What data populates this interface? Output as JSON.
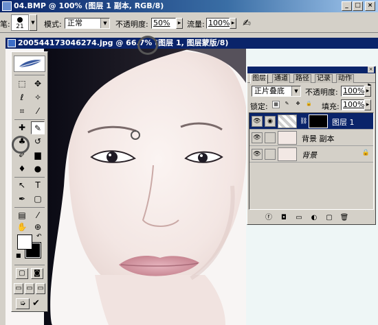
{
  "window": {
    "title": "04.BMP @ 100% (图层 1 副本, RGB/8)",
    "minimize": "_",
    "restore": "□",
    "close": "×"
  },
  "options_bar": {
    "tool_label_fragment": "笔:",
    "brush_size": "21",
    "mode_label": "模式:",
    "mode_value": "正常",
    "opacity_label": "不透明度:",
    "opacity_value": "50%",
    "flow_label": "流量:",
    "flow_value": "100%"
  },
  "document": {
    "title": "200544173046274.jpg @ 66.7% (图层 1, 图层蒙版/8)"
  },
  "toolbox": {
    "tools": [
      {
        "name": "rect-marquee-tool",
        "glyph": "⬚"
      },
      {
        "name": "move-tool",
        "glyph": "✥"
      },
      {
        "name": "lasso-tool",
        "glyph": "ℓ"
      },
      {
        "name": "magic-wand-tool",
        "glyph": "✧"
      },
      {
        "name": "crop-tool",
        "glyph": "⌗"
      },
      {
        "name": "slice-tool",
        "glyph": "✎"
      },
      {
        "name": "healing-brush-tool",
        "glyph": "✚"
      },
      {
        "name": "brush-tool",
        "glyph": "✎"
      },
      {
        "name": "clone-stamp-tool",
        "glyph": "♣"
      },
      {
        "name": "history-brush-tool",
        "glyph": "↺"
      },
      {
        "name": "eraser-tool",
        "glyph": "▭"
      },
      {
        "name": "gradient-tool",
        "glyph": "▆"
      },
      {
        "name": "blur-tool",
        "glyph": "💧"
      },
      {
        "name": "dodge-tool",
        "glyph": "●"
      },
      {
        "name": "path-select-tool",
        "glyph": "↖"
      },
      {
        "name": "type-tool",
        "glyph": "T"
      },
      {
        "name": "pen-tool",
        "glyph": "✒"
      },
      {
        "name": "shape-tool",
        "glyph": "▢"
      },
      {
        "name": "notes-tool",
        "glyph": "▤"
      },
      {
        "name": "eyedropper-tool",
        "glyph": "✐"
      },
      {
        "name": "hand-tool",
        "glyph": "✋"
      },
      {
        "name": "zoom-tool",
        "glyph": "🔍"
      }
    ],
    "selected_tool": "brush-tool",
    "foreground_color": "#ffffff",
    "background_color": "#000000"
  },
  "layers_panel": {
    "tabs": [
      "图层",
      "通道",
      "路径",
      "记录",
      "动作"
    ],
    "active_tab": "图层",
    "blend_mode": "正片叠底",
    "opacity_label": "不透明度:",
    "opacity_value": "100%",
    "lock_label": "锁定:",
    "fill_label": "填充:",
    "fill_value": "100%",
    "layers": [
      {
        "name": "图层 1",
        "active": true,
        "has_mask": true
      },
      {
        "name": "背景 副本",
        "active": false,
        "has_mask": false
      },
      {
        "name": "背景",
        "active": false,
        "has_mask": false,
        "locked": true
      }
    ]
  },
  "colors": {
    "title_bar": "#0a246a",
    "chrome": "#d4d0c8"
  }
}
